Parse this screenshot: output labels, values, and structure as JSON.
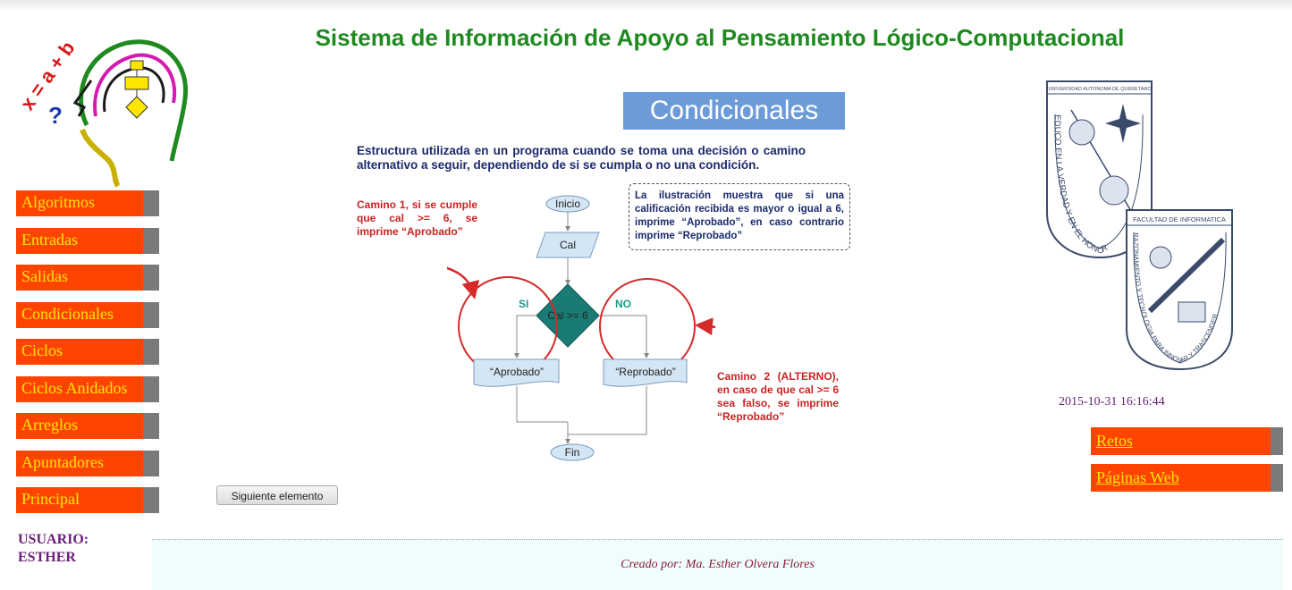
{
  "header": {
    "title": "Sistema de Información de Apoyo al Pensamiento Lógico-Computacional"
  },
  "logo_left": {
    "formula": "x = a + b",
    "question": "?"
  },
  "sidebar": {
    "items": [
      {
        "label": "Algoritmos"
      },
      {
        "label": "Entradas"
      },
      {
        "label": "Salidas"
      },
      {
        "label": "Condicionales"
      },
      {
        "label": "Ciclos"
      },
      {
        "label": "Ciclos Anidados"
      },
      {
        "label": "Arreglos"
      },
      {
        "label": "Apuntadores"
      },
      {
        "label": "Principal"
      }
    ]
  },
  "user": {
    "label": "USUARIO:",
    "name": "ESTHER"
  },
  "content": {
    "section_title": "Condicionales",
    "description": "Estructura utilizada en un programa cuando se toma una decisión o camino alternativo a seguir, dependiendo de si se cumpla o no una condición.",
    "note": "La ilustración muestra que si una calificación recibida es mayor o igual a 6, imprime “Aprobado”, en caso contrario imprime “Reprobado”",
    "path1": "Camino 1, si se cumple que cal >= 6, se imprime “Aprobado”",
    "path2": "Camino 2 (ALTERNO), en caso de que cal >= 6 sea falso, se imprime “Reprobado”",
    "flow": {
      "start": "Inicio",
      "input": "Cal",
      "decision": "Cal >= 6",
      "yes": "SI",
      "no": "NO",
      "out_yes": "“Aprobado”",
      "out_no": "“Reprobado”",
      "end": "Fin"
    },
    "next_button": "Siguiente elemento"
  },
  "logo_right": {
    "seal1_top": "UNIVERSIDAD AUTONOMA DE QUERETARO",
    "seal1_motto": "EDUCO EN LA VERDAD Y EN EL HONOR",
    "seal2_top": "FACULTAD DE INFORMATICA",
    "seal2_motto": "RAZONAMIENTO Y TECNOLOGIA PARA INNOVAR Y TRASCENDER"
  },
  "datetime": "2015-10-31 16:16:44",
  "right_menu": {
    "items": [
      {
        "label": "Retos"
      },
      {
        "label": "Páginas Web"
      }
    ]
  },
  "footer": {
    "credit": "Creado por: Ma. Esther Olvera Flores"
  },
  "colors": {
    "menu_bg": "#ff4400",
    "menu_text": "#ffe600",
    "title": "#1f8a1f",
    "section_bg": "#6d9bd8",
    "decision": "#1a7a74"
  }
}
